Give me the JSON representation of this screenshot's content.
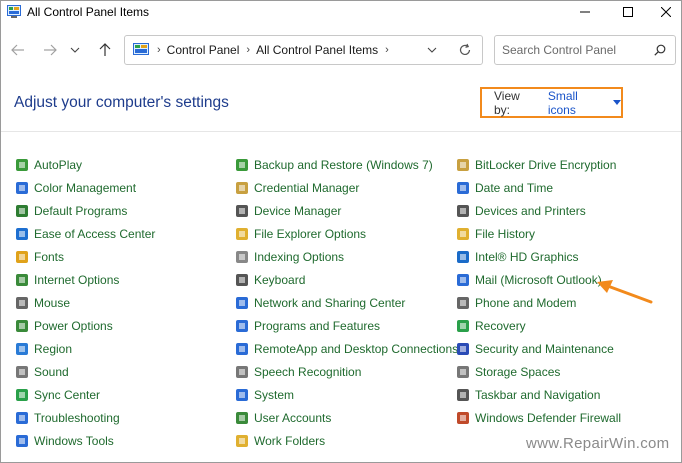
{
  "window": {
    "title": "All Control Panel Items"
  },
  "nav": {
    "breadcrumbs": [
      "Control Panel",
      "All Control Panel Items"
    ],
    "search_placeholder": "Search Control Panel"
  },
  "header": {
    "heading": "Adjust your computer's settings",
    "view_by_label": "View by:",
    "view_by_value": "Small icons"
  },
  "columns": [
    [
      {
        "label": "AutoPlay",
        "icon": "autoplay-icon",
        "color": "#3a9a3a"
      },
      {
        "label": "Color Management",
        "icon": "color-management-icon",
        "color": "#2a6bd6"
      },
      {
        "label": "Default Programs",
        "icon": "default-programs-icon",
        "color": "#2e7d32"
      },
      {
        "label": "Ease of Access Center",
        "icon": "ease-of-access-icon",
        "color": "#1e6fd0"
      },
      {
        "label": "Fonts",
        "icon": "fonts-icon",
        "color": "#e0a21a"
      },
      {
        "label": "Internet Options",
        "icon": "internet-options-icon",
        "color": "#3a8a3a"
      },
      {
        "label": "Mouse",
        "icon": "mouse-icon",
        "color": "#666666"
      },
      {
        "label": "Power Options",
        "icon": "power-options-icon",
        "color": "#3a8a3a"
      },
      {
        "label": "Region",
        "icon": "region-icon",
        "color": "#2a7bd6"
      },
      {
        "label": "Sound",
        "icon": "sound-icon",
        "color": "#777777"
      },
      {
        "label": "Sync Center",
        "icon": "sync-center-icon",
        "color": "#2aa04a"
      },
      {
        "label": "Troubleshooting",
        "icon": "troubleshooting-icon",
        "color": "#2a6bd6"
      },
      {
        "label": "Windows Tools",
        "icon": "windows-tools-icon",
        "color": "#2a6bd6"
      }
    ],
    [
      {
        "label": "Backup and Restore (Windows 7)",
        "icon": "backup-restore-icon",
        "color": "#3a9a3a"
      },
      {
        "label": "Credential Manager",
        "icon": "credential-manager-icon",
        "color": "#c8a040"
      },
      {
        "label": "Device Manager",
        "icon": "device-manager-icon",
        "color": "#555555"
      },
      {
        "label": "File Explorer Options",
        "icon": "file-explorer-options-icon",
        "color": "#e0b030"
      },
      {
        "label": "Indexing Options",
        "icon": "indexing-options-icon",
        "color": "#888888"
      },
      {
        "label": "Keyboard",
        "icon": "keyboard-icon",
        "color": "#555555"
      },
      {
        "label": "Network and Sharing Center",
        "icon": "network-sharing-icon",
        "color": "#2a6bd6"
      },
      {
        "label": "Programs and Features",
        "icon": "programs-features-icon",
        "color": "#2a6bd6"
      },
      {
        "label": "RemoteApp and Desktop Connections",
        "icon": "remoteapp-icon",
        "color": "#2a6bd6"
      },
      {
        "label": "Speech Recognition",
        "icon": "speech-recognition-icon",
        "color": "#777777"
      },
      {
        "label": "System",
        "icon": "system-icon",
        "color": "#2a6bd6"
      },
      {
        "label": "User Accounts",
        "icon": "user-accounts-icon",
        "color": "#3a8a3a"
      },
      {
        "label": "Work Folders",
        "icon": "work-folders-icon",
        "color": "#e0b030"
      }
    ],
    [
      {
        "label": "BitLocker Drive Encryption",
        "icon": "bitlocker-icon",
        "color": "#c8a040"
      },
      {
        "label": "Date and Time",
        "icon": "date-time-icon",
        "color": "#2a6bd6"
      },
      {
        "label": "Devices and Printers",
        "icon": "devices-printers-icon",
        "color": "#555555"
      },
      {
        "label": "File History",
        "icon": "file-history-icon",
        "color": "#e0b030"
      },
      {
        "label": "Intel® HD Graphics",
        "icon": "intel-graphics-icon",
        "color": "#1a6bc8"
      },
      {
        "label": "Mail (Microsoft Outlook)",
        "icon": "mail-icon",
        "color": "#2a6bd6"
      },
      {
        "label": "Phone and Modem",
        "icon": "phone-modem-icon",
        "color": "#666666"
      },
      {
        "label": "Recovery",
        "icon": "recovery-icon",
        "color": "#2aa04a"
      },
      {
        "label": "Security and Maintenance",
        "icon": "security-maintenance-icon",
        "color": "#2a4bb6"
      },
      {
        "label": "Storage Spaces",
        "icon": "storage-spaces-icon",
        "color": "#777777"
      },
      {
        "label": "Taskbar and Navigation",
        "icon": "taskbar-navigation-icon",
        "color": "#555555"
      },
      {
        "label": "Windows Defender Firewall",
        "icon": "firewall-icon",
        "color": "#c04a2a"
      }
    ]
  ],
  "colors": {
    "link_green": "#1f6a2e",
    "heading_blue": "#1e3c8c",
    "highlight_orange": "#f28a1c"
  },
  "watermark": "www.RepairWin.com"
}
